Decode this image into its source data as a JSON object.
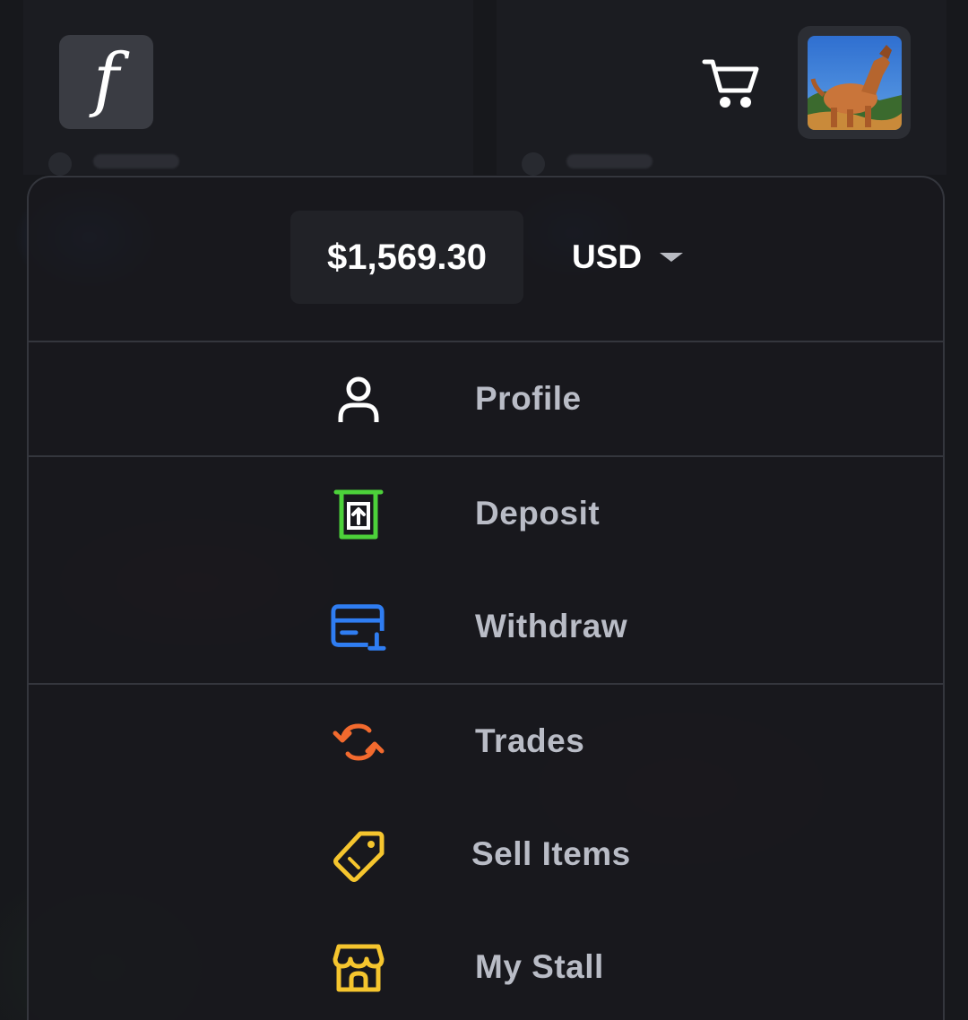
{
  "header": {
    "logo_letter": "f",
    "cart_icon": "cart-icon",
    "avatar_icon": "user-avatar"
  },
  "wallet": {
    "balance": "$1,569.30",
    "currency": "USD",
    "caret_icon": "caret-down-icon"
  },
  "menu": {
    "items": [
      {
        "label": "Profile",
        "icon": "user-icon",
        "color": "#ffffff"
      },
      {
        "label": "Deposit",
        "icon": "deposit-icon",
        "color": "#4cd13a"
      },
      {
        "label": "Withdraw",
        "icon": "credit-card-icon",
        "color": "#2f7df2"
      },
      {
        "label": "Trades",
        "icon": "exchange-icon",
        "color": "#f26a2e"
      },
      {
        "label": "Sell Items",
        "icon": "tag-icon",
        "color": "#f5c52e"
      },
      {
        "label": "My Stall",
        "icon": "store-icon",
        "color": "#f5c52e"
      }
    ]
  }
}
